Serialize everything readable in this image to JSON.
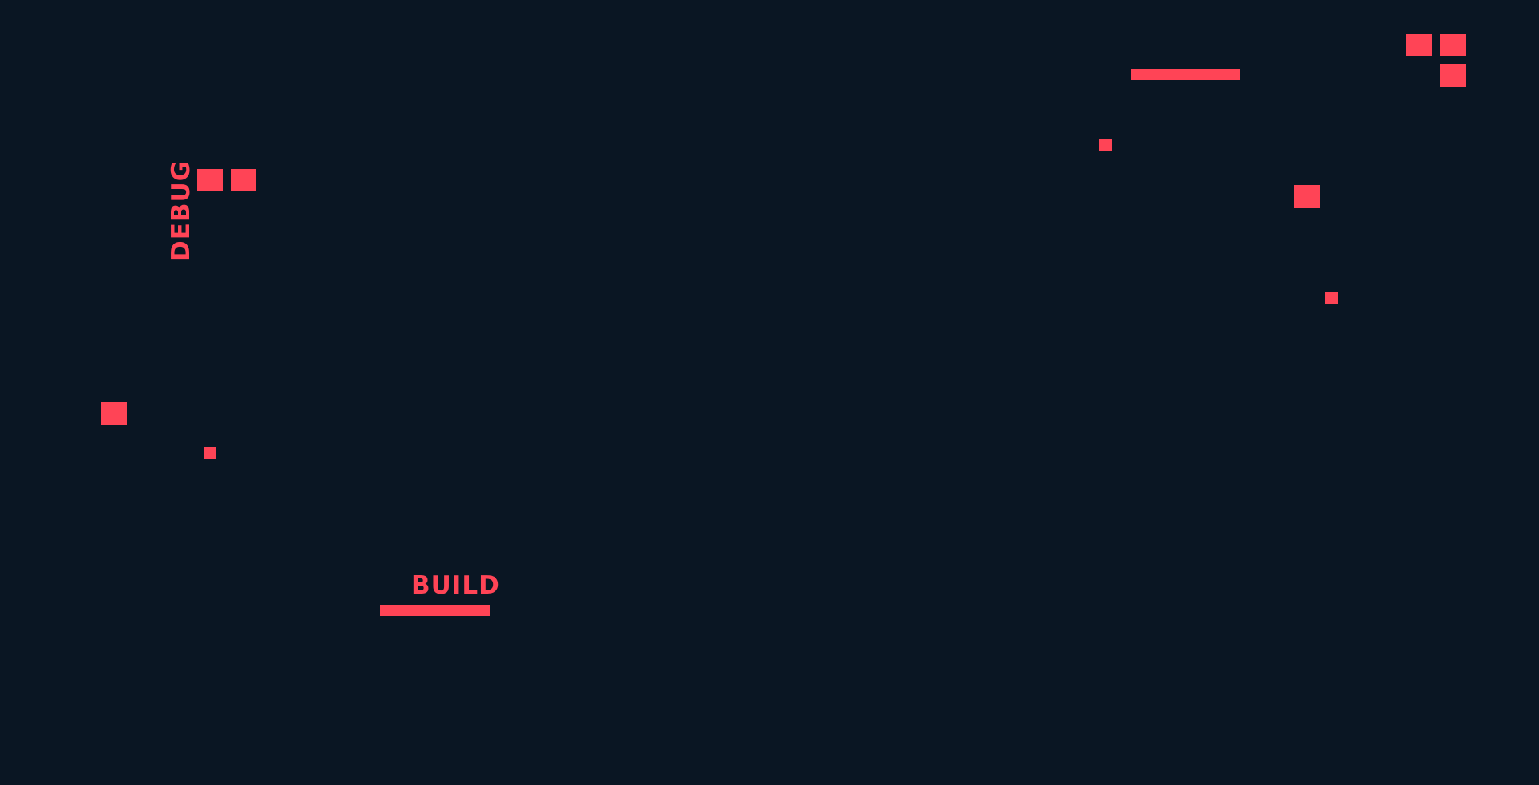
{
  "screen": {
    "background_color": "#0a1623",
    "accent_color": "#ff4456"
  },
  "labels": {
    "debug": "DEBUG",
    "build": "BUILD"
  }
}
